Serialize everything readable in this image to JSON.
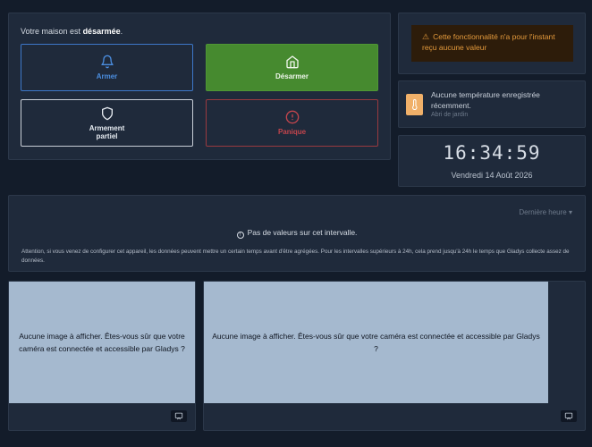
{
  "alarm": {
    "status_prefix": "Votre maison est",
    "status_value": "désarmée",
    "status_suffix": ".",
    "arm_label": "Armer",
    "disarm_label": "Désarmer",
    "partial_label_line1": "Armement",
    "partial_label_line2": "partiel",
    "panic_label": "Panique"
  },
  "warning": {
    "text": "Cette fonctionnalité n'a pour l'instant reçu aucune valeur"
  },
  "temperature": {
    "text": "Aucune température enregistrée récemment.",
    "location": "Abri de jardin",
    "icon": "thermometer-icon"
  },
  "clock": {
    "time": "16:34:59",
    "date": "Vendredi 14 Août 2026"
  },
  "history": {
    "dropdown_label": "Dernière heure",
    "empty_text": "Pas de valeurs sur cet intervalle.",
    "note": "Attention, si vous venez de configurer cet appareil, les données peuvent mettre un certain temps avant d'être agrégées. Pour les intervalles supérieurs à 24h, cela prend jusqu'à 24h le temps que Gladys collecte assez de données."
  },
  "cameras": [
    {
      "message": "Aucune image à afficher. Êtes-vous sûr que votre caméra est connectée et accessible par Gladys ?"
    },
    {
      "message": "Aucune image à afficher. Êtes-vous sûr que votre caméra est connectée et accessible par Gladys ?"
    }
  ],
  "colors": {
    "background": "#131c2a",
    "card": "#1f2a3b",
    "arm": "#4b8ee0",
    "disarm": "#468a2f",
    "panic": "#c4454d",
    "warning": "#e49a3c",
    "temp_icon": "#f0b069",
    "camera_placeholder": "#a5b9cf"
  }
}
